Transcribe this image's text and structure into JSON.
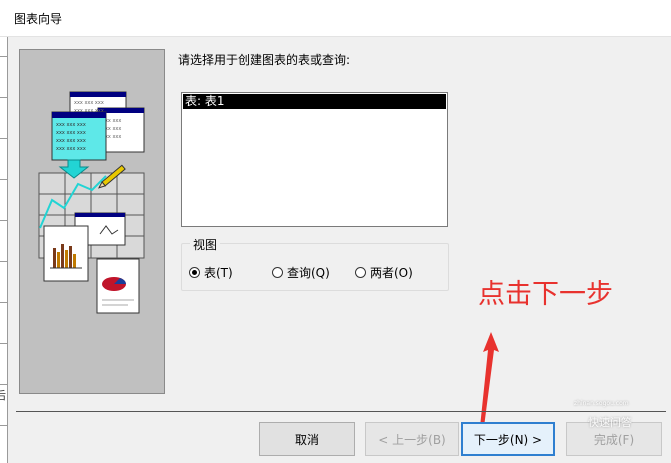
{
  "window": {
    "title": "图表向导"
  },
  "main": {
    "prompt": "请选择用于创建图表的表或查询:",
    "list_items": [
      "表: 表1"
    ]
  },
  "view_group": {
    "legend": "视图",
    "options": [
      {
        "label": "表(T)",
        "selected": true
      },
      {
        "label": "查询(Q)",
        "selected": false
      },
      {
        "label": "两者(O)",
        "selected": false
      }
    ]
  },
  "left_strip": {
    "partial_char": "后"
  },
  "annotation": {
    "text": "点击下一步",
    "color": "#e8322e"
  },
  "buttons": {
    "cancel": "取消",
    "back": "< 上一步(B)",
    "next": "下一步(N) >",
    "finish": "完成(F)"
  },
  "watermark": {
    "text": "快速问答",
    "domain": "zhinan.sogou.com"
  },
  "colors": {
    "accent": "#2f7fd0",
    "selection": "#000000",
    "illustration_bg": "#c0c0c0"
  }
}
